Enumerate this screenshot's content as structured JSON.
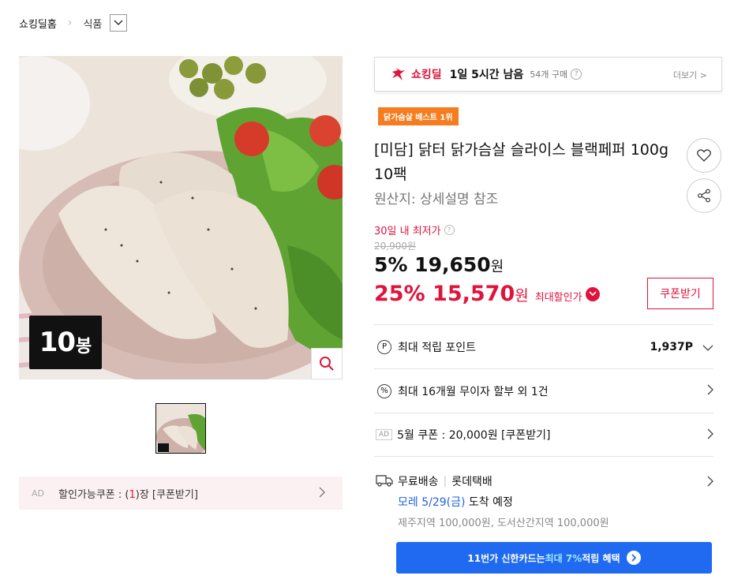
{
  "breadcrumb": {
    "home": "쇼킹딜홈",
    "category": "식품"
  },
  "image": {
    "badge_number": "10",
    "badge_unit": "봉"
  },
  "ad_coupon": {
    "ad": "AD",
    "prefix": "할인가능쿠폰 : (",
    "count": "1",
    "suffix": ")장 [쿠폰받기]"
  },
  "deal": {
    "brand": "쇼킹딜",
    "remaining": "1일 5시간 남음",
    "purchases": "54개 구매",
    "help": "?",
    "more": "더보기 >"
  },
  "best_badge": "닭가슴살 베스트 1위",
  "product": {
    "title": "[미담] 닭터 닭가슴살 슬라이스 블랙페퍼 100g 10팩",
    "origin": "원산지: 상세설명 참조"
  },
  "price": {
    "lowest_label": "30일 내 최저가",
    "original": "20,900원",
    "discount1_rate": "5%",
    "discount1_price": "19,650",
    "won": "원",
    "discount2_rate": "25%",
    "discount2_price": "15,570",
    "max_label": "최대할인가",
    "coupon_button": "쿠폰받기"
  },
  "benefits": {
    "points_label": "최대 적립 포인트",
    "points_value": "1,937P",
    "installment": "최대 16개월 무이자 할부 외 1건",
    "ad": "AD",
    "coupon": "5월 쿠폰 : 20,000원 [쿠폰받기]"
  },
  "shipping": {
    "free": "무료배송",
    "carrier": "롯데택배",
    "arrival_date": "모레 5/29(금)",
    "arrival_suffix": " 도착 예정",
    "extra": "제주지역 100,000원, 도서산간지역 100,000원"
  },
  "card_banner": {
    "prefix": "11번가 신한카드는 ",
    "highlight": "최대 7%",
    "suffix": " 적립 혜택"
  },
  "colors": {
    "accent_red": "#e0133b",
    "best_orange": "#f57d20",
    "banner_blue": "#1f6af1"
  }
}
